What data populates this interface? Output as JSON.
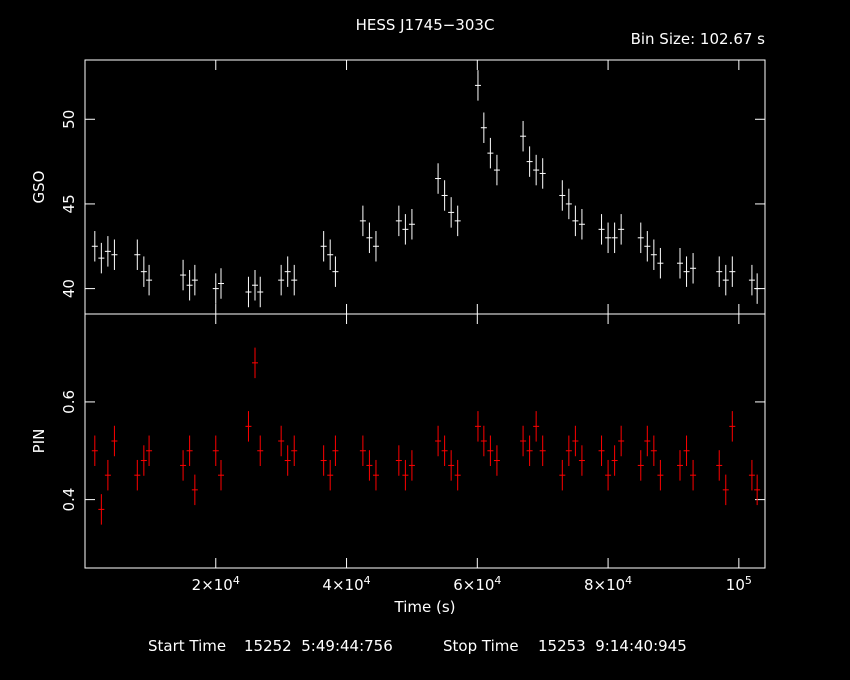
{
  "chart_data": {
    "type": "line",
    "title": "HESS J1745−303C",
    "bin_size": "Bin Size: 102.67 s",
    "xlabel": "Time (s)",
    "xlim": [
      0,
      104000
    ],
    "x_ticks": [
      {
        "value": 20000,
        "mant": "2×10",
        "exp": "4"
      },
      {
        "value": 40000,
        "mant": "4×10",
        "exp": "4"
      },
      {
        "value": 60000,
        "mant": "6×10",
        "exp": "4"
      },
      {
        "value": 80000,
        "mant": "8×10",
        "exp": "4"
      },
      {
        "value": 100000,
        "mant": "10",
        "exp": "5"
      }
    ],
    "footer": {
      "start_label": "Start Time",
      "start_value": "15252  5:49:44:756",
      "stop_label": "Stop Time",
      "stop_value": "15253  9:14:40:945"
    },
    "panels": [
      {
        "ylabel": "GSO",
        "color": "#ffffff",
        "ylim": [
          38.5,
          53.5
        ],
        "y_ticks": [
          40,
          45,
          50
        ],
        "series": {
          "x": [
            1500,
            2500,
            3500,
            4500,
            8000,
            9000,
            9800,
            15000,
            16000,
            16800,
            20000,
            20800,
            25000,
            26000,
            26800,
            30000,
            31000,
            32000,
            36500,
            37500,
            38300,
            42500,
            43500,
            44500,
            48000,
            49000,
            50000,
            54000,
            55000,
            56000,
            57000,
            60100,
            61000,
            62000,
            63000,
            67000,
            68000,
            69000,
            70000,
            73000,
            74000,
            75000,
            76000,
            79000,
            80000,
            81000,
            82000,
            85000,
            86000,
            87000,
            88000,
            91000,
            92000,
            93000,
            97000,
            98000,
            99000,
            102000,
            102800
          ],
          "y": [
            42.5,
            41.8,
            42.2,
            42.0,
            42.0,
            41.0,
            40.5,
            40.8,
            40.2,
            40.5,
            40.0,
            40.3,
            39.8,
            40.2,
            39.8,
            40.5,
            41.0,
            40.5,
            42.5,
            42.0,
            41.0,
            44.0,
            43.0,
            42.5,
            44.0,
            43.5,
            43.8,
            46.5,
            45.5,
            44.5,
            44.0,
            52.0,
            49.5,
            48.0,
            47.0,
            49.0,
            47.5,
            47.0,
            46.8,
            45.5,
            45.0,
            44.0,
            43.8,
            43.5,
            43.0,
            43.0,
            43.5,
            43.0,
            42.5,
            42.0,
            41.5,
            41.5,
            41.0,
            41.2,
            41.0,
            40.5,
            41.0,
            40.5,
            40.0
          ]
        }
      },
      {
        "ylabel": "PIN",
        "color": "#ff0000",
        "ylim": [
          0.26,
          0.78
        ],
        "y_ticks": [
          0.4,
          0.6
        ],
        "series": {
          "x": [
            1500,
            2500,
            3500,
            4500,
            8000,
            9000,
            9800,
            15000,
            16000,
            16800,
            20000,
            20800,
            25000,
            26000,
            26800,
            30000,
            31000,
            32000,
            36500,
            37500,
            38300,
            42500,
            43500,
            44500,
            48000,
            49000,
            50000,
            54000,
            55000,
            56000,
            57000,
            60100,
            61000,
            62000,
            63000,
            67000,
            68000,
            69000,
            70000,
            73000,
            74000,
            75000,
            76000,
            79000,
            80000,
            81000,
            82000,
            85000,
            86000,
            87000,
            88000,
            91000,
            92000,
            93000,
            97000,
            98000,
            99000,
            102000,
            102800
          ],
          "y": [
            0.5,
            0.38,
            0.45,
            0.52,
            0.45,
            0.48,
            0.5,
            0.47,
            0.5,
            0.42,
            0.5,
            0.45,
            0.55,
            0.68,
            0.5,
            0.52,
            0.48,
            0.5,
            0.48,
            0.45,
            0.5,
            0.5,
            0.47,
            0.45,
            0.48,
            0.45,
            0.47,
            0.52,
            0.5,
            0.47,
            0.45,
            0.55,
            0.52,
            0.5,
            0.48,
            0.52,
            0.5,
            0.55,
            0.5,
            0.45,
            0.5,
            0.52,
            0.48,
            0.5,
            0.45,
            0.48,
            0.52,
            0.47,
            0.52,
            0.5,
            0.45,
            0.47,
            0.5,
            0.45,
            0.47,
            0.42,
            0.55,
            0.45,
            0.42
          ]
        }
      }
    ]
  }
}
